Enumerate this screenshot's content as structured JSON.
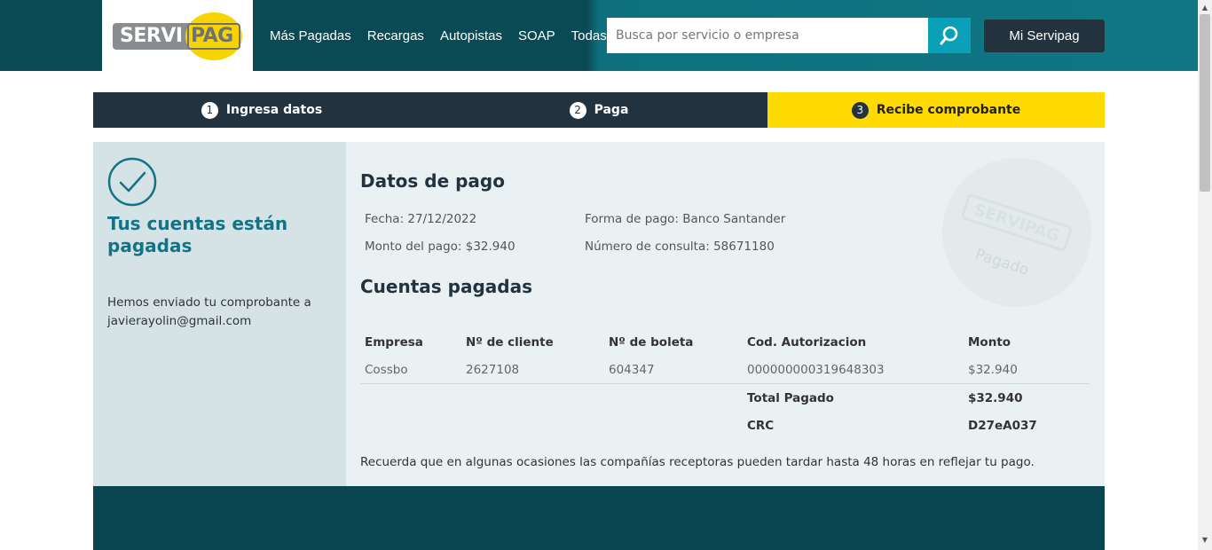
{
  "header": {
    "logo_left": "SERVI",
    "logo_right": "PAG",
    "nav": [
      "Más Pagadas",
      "Recargas",
      "Autopistas",
      "SOAP",
      "Todas"
    ],
    "search_placeholder": "Busca por servicio o empresa",
    "account_button": "Mi Servipag"
  },
  "steps": [
    {
      "num": "1",
      "label": "Ingresa datos"
    },
    {
      "num": "2",
      "label": "Paga"
    },
    {
      "num": "3",
      "label": "Recibe comprobante"
    }
  ],
  "left": {
    "title": "Tus cuentas están pagadas",
    "sent_text": "Hemos enviado tu comprobante a",
    "email": "javierayolin@gmail.com"
  },
  "payment": {
    "title": "Datos de pago",
    "fecha": "Fecha: 27/12/2022",
    "forma": "Forma de pago: Banco Santander",
    "monto": "Monto del pago: $32.940",
    "consulta": "Número de consulta: 58671180"
  },
  "stamp": {
    "logo": "SERVIPAG",
    "text": "Pagado"
  },
  "accounts": {
    "title": "Cuentas pagadas",
    "headers": [
      "Empresa",
      "Nº de cliente",
      "Nº de boleta",
      "Cod. Autorizacion",
      "Monto"
    ],
    "rows": [
      [
        "Cossbo",
        "2627108",
        "604347",
        "000000000319648303",
        "$32.940"
      ]
    ],
    "total_label": "Total Pagado",
    "total_value": "$32.940",
    "crc_label": "CRC",
    "crc_value": "D27eA037"
  },
  "note": "Recuerda que en algunas ocasiones las compañías receptoras pueden tardar hasta 48 horas en reflejar tu pago."
}
